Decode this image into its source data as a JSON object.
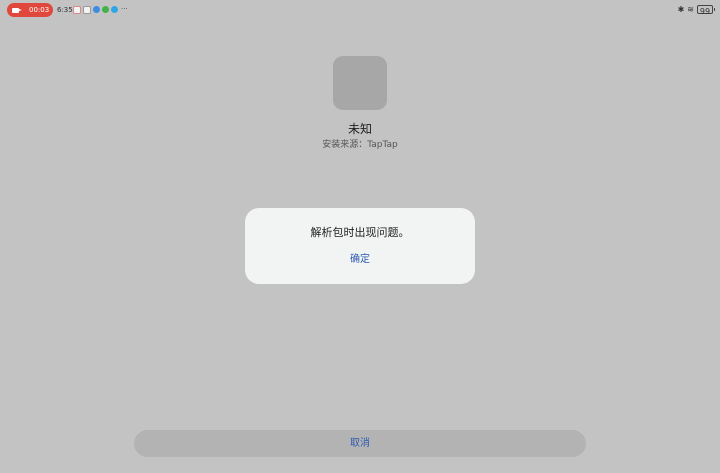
{
  "status_bar": {
    "recording_time": "00:03",
    "clock": "6:35",
    "notification_icons": [
      "notification-icon",
      "notification-icon",
      "app-icon",
      "wechat-icon",
      "app-icon"
    ],
    "more": "···",
    "battery": "99"
  },
  "app": {
    "name": "未知",
    "install_source": "安装来源：TapTap"
  },
  "dialog": {
    "message": "解析包时出现问题。",
    "confirm_label": "确定"
  },
  "footer": {
    "cancel_label": "取消"
  },
  "colors": {
    "background": "#c3c3c3",
    "dialog_background": "#f2f3f3",
    "accent": "#2f5bb0",
    "recording": "#e0483d"
  }
}
